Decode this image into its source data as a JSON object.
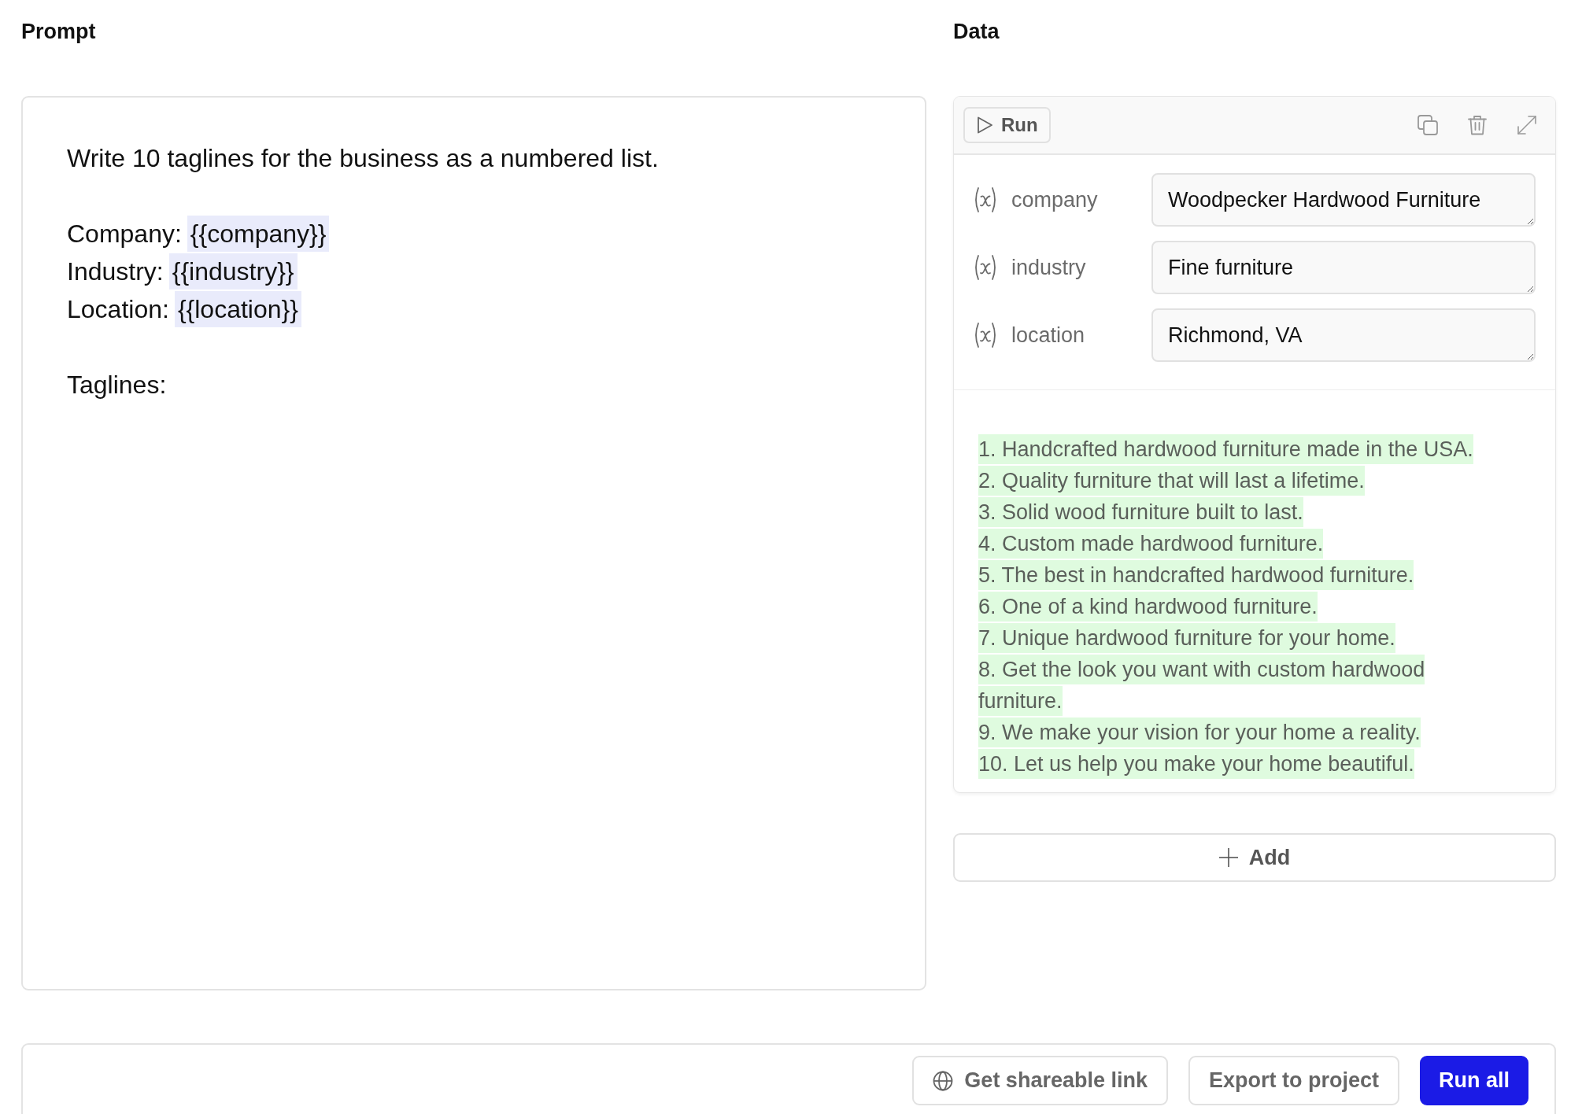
{
  "prompt": {
    "title": "Prompt",
    "paragraphs": [
      [
        {
          "text": "Write 10 taglines for the business as a numbered list."
        }
      ],
      [
        {
          "text": "Company:",
          "variable": "{{company}}"
        },
        {
          "text": "Industry:",
          "variable": "{{industry}}"
        },
        {
          "text": "Location:",
          "variable": "{{location}}"
        }
      ],
      [
        {
          "text": "Taglines:"
        }
      ]
    ]
  },
  "data": {
    "title": "Data",
    "run_button": "Run",
    "variables": [
      {
        "name": "company",
        "value": "Woodpecker Hardwood Furniture"
      },
      {
        "name": "industry",
        "value": "Fine furniture"
      },
      {
        "name": "location",
        "value": "Richmond, VA"
      }
    ],
    "output": [
      "1. Handcrafted hardwood furniture made in the USA.",
      "2. Quality furniture that will last a lifetime.",
      "3. Solid wood furniture built to last.",
      "4. Custom made hardwood furniture.",
      "5. The best in handcrafted hardwood furniture.",
      "6. One of a kind hardwood furniture.",
      "7. Unique hardwood furniture for your home.",
      "8. Get the look you want with custom hardwood furniture.",
      "9. We make your vision for your home a reality.",
      "10. Let us help you make your home beautiful."
    ],
    "add_button": "Add"
  },
  "actions": [
    {
      "kind": "share",
      "label": "Get shareable link"
    },
    {
      "kind": "secondary",
      "label": "Export to project"
    },
    {
      "kind": "primary",
      "label": "Run all"
    }
  ]
}
